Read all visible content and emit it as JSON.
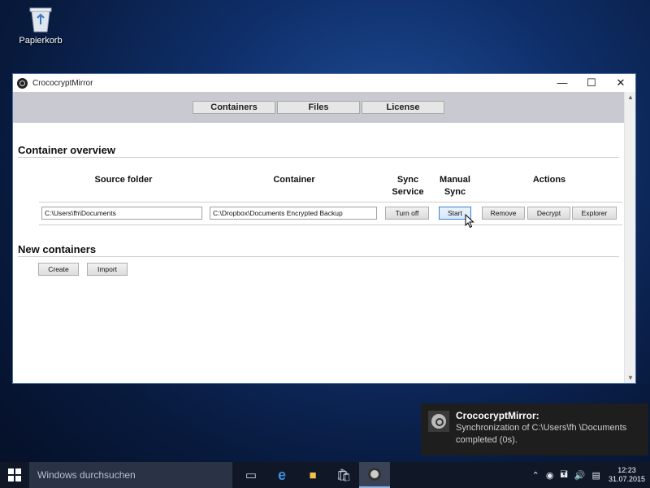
{
  "desktop": {
    "recycle_bin_label": "Papierkorb"
  },
  "window": {
    "title": "CrococryptMirror",
    "tabs": [
      "Containers",
      "Files",
      "License"
    ],
    "container_overview": {
      "title": "Container overview",
      "columns": {
        "source_folder": "Source folder",
        "container": "Container",
        "sync_service": "Sync\nService",
        "manual_sync": "Manual\nSync",
        "actions": "Actions"
      },
      "row": {
        "source": "C:\\Users\\fh\\Documents",
        "container": "C:\\Dropbox\\Documents Encrypted Backup",
        "sync_button": "Turn off",
        "manual_button": "Start",
        "actions": [
          "Remove",
          "Decrypt",
          "Explorer"
        ]
      }
    },
    "new_containers": {
      "title": "New containers",
      "buttons": [
        "Create",
        "Import"
      ]
    }
  },
  "notification": {
    "title": "CrococryptMirror:",
    "body": "Synchronization of C:\\Users\\fh \\Documents completed (0s)."
  },
  "taskbar": {
    "search_placeholder": "Windows durchsuchen",
    "time": "12:23",
    "date": "31.07.2015"
  }
}
